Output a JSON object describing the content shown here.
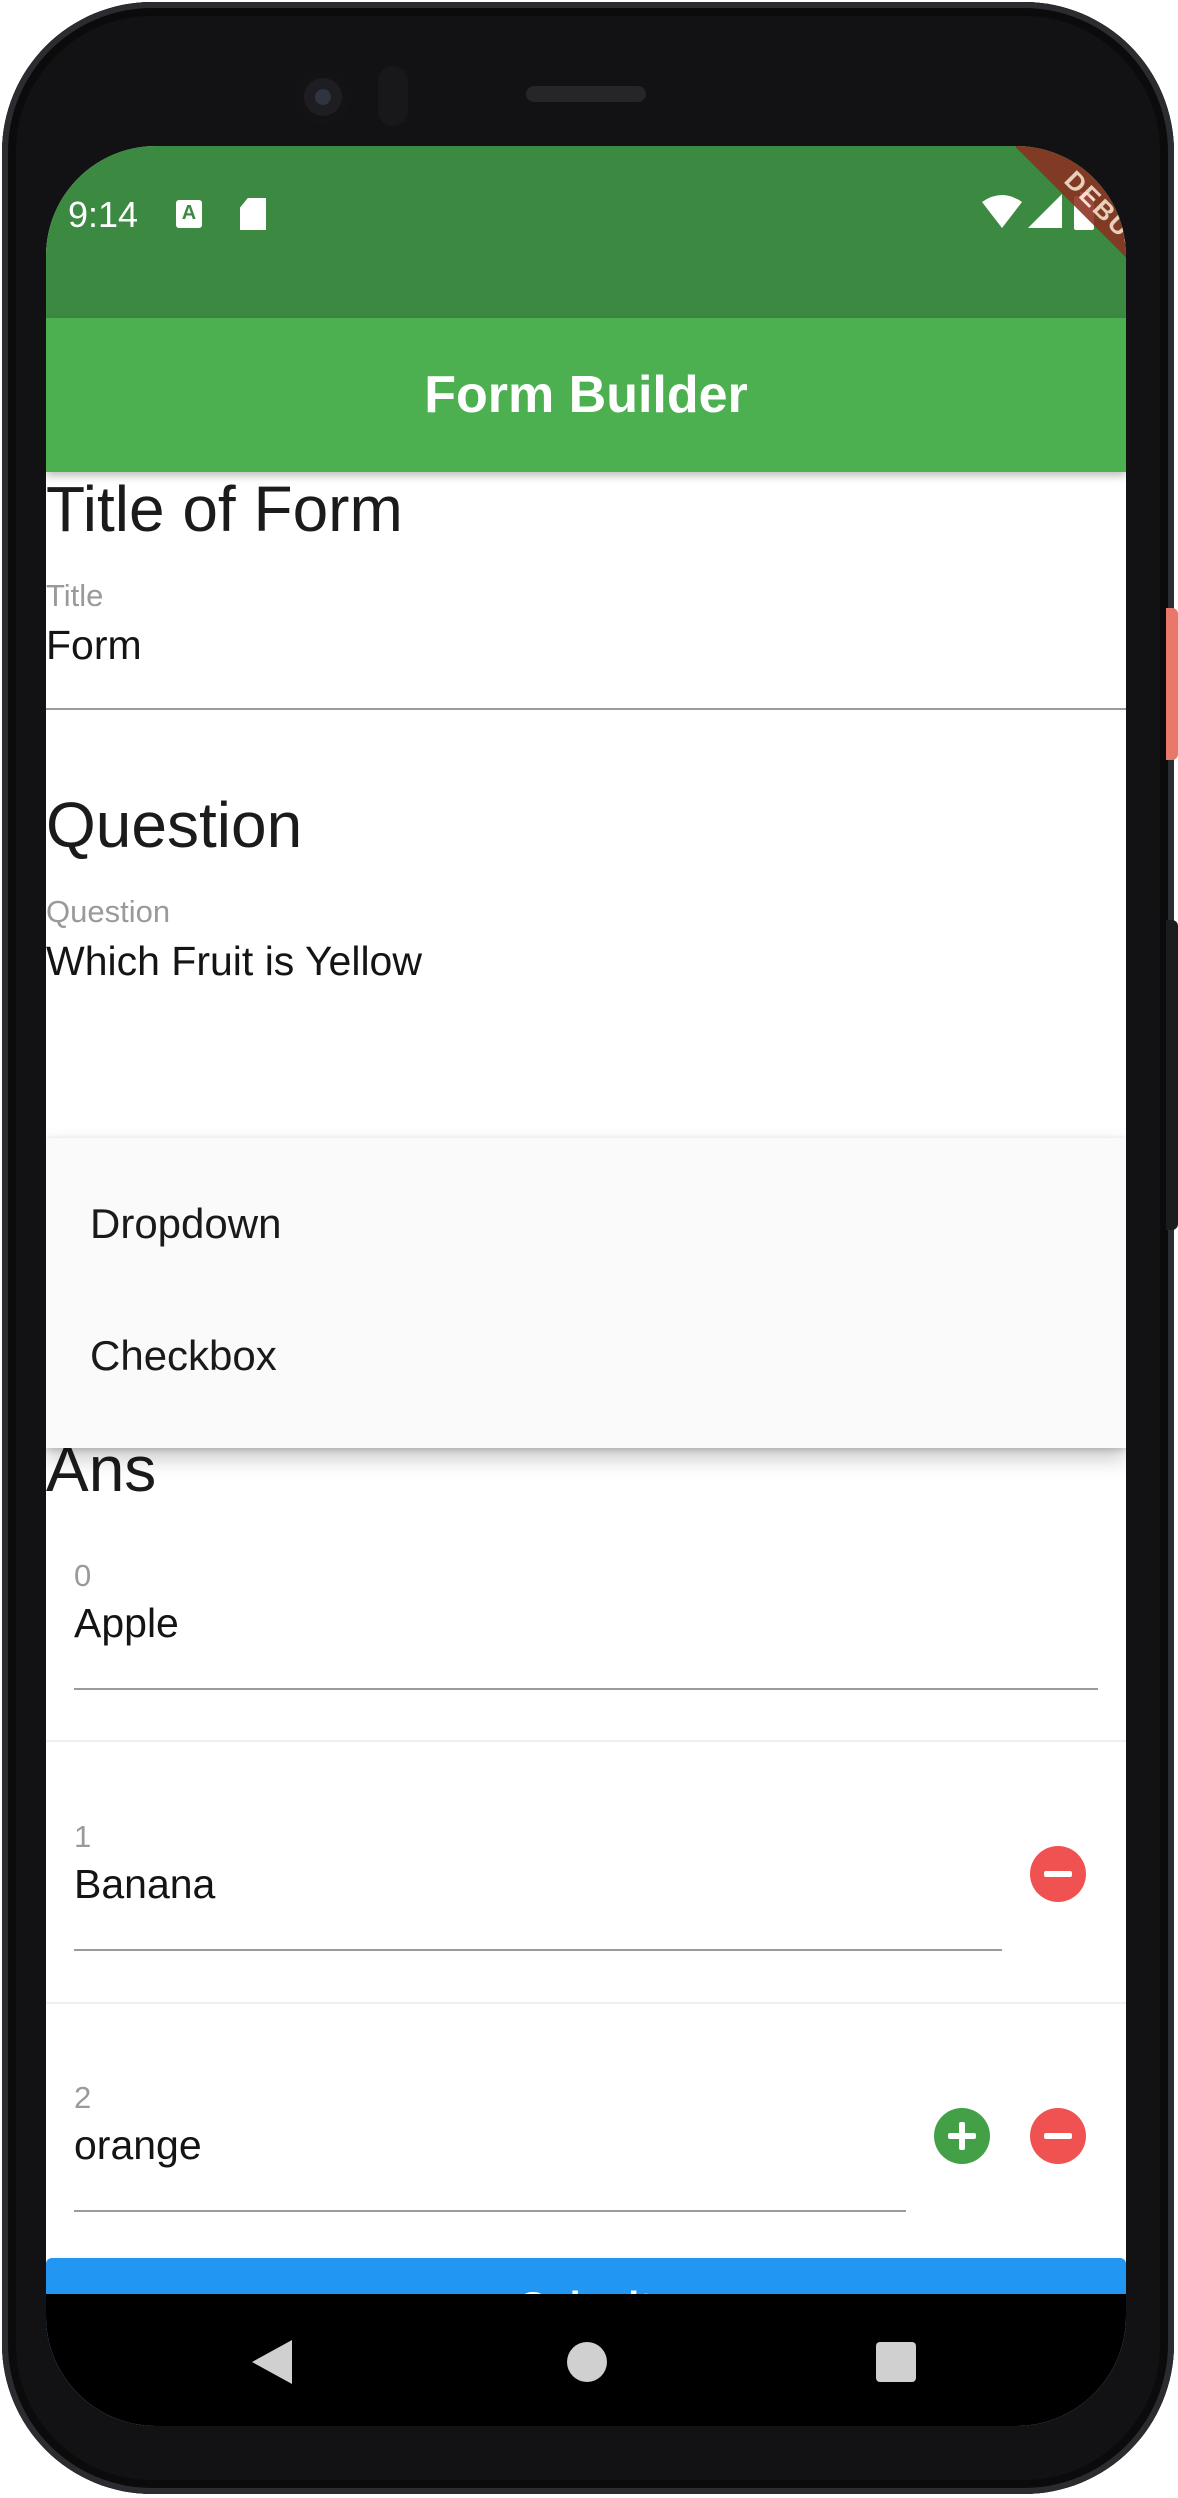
{
  "status_bar": {
    "time": "9:14",
    "left_icons": [
      "keyboard-a-icon",
      "sd-card-icon"
    ],
    "right_icons": [
      "wifi-icon",
      "signal-icon",
      "battery-icon"
    ],
    "debug_banner": "DEBUG"
  },
  "app_bar": {
    "title": "Form Builder",
    "color": "#4caf50",
    "status_color": "#3c8a42"
  },
  "form_title": {
    "heading": "Title of Form",
    "label": "Title",
    "value": "Form"
  },
  "question": {
    "heading": "Question",
    "label": "Question",
    "value": "Which Fruit is Yellow"
  },
  "type_menu": {
    "options": [
      "Dropdown",
      "Checkbox"
    ]
  },
  "answers": {
    "heading": "Ans",
    "items": [
      {
        "label": "0",
        "value": "Apple"
      },
      {
        "label": "1",
        "value": "Banana"
      },
      {
        "label": "2",
        "value": "orange"
      }
    ]
  },
  "submit_label": "Submit",
  "colors": {
    "submit": "#2196f3",
    "remove": "#f05252",
    "add": "#43a047"
  },
  "nav_bar": {
    "icons": [
      "back-icon",
      "home-icon",
      "recents-icon"
    ]
  }
}
